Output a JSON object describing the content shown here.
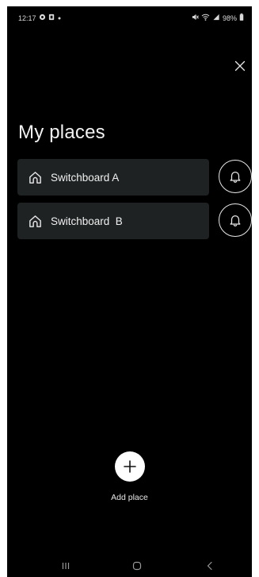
{
  "status_bar": {
    "time": "12:17",
    "battery": "98%",
    "left_icons": [
      "whatsapp-icon",
      "notification-icon",
      "dot-icon"
    ],
    "right_icons": [
      "mute-icon",
      "wifi-icon",
      "signal-icon",
      "battery-icon"
    ]
  },
  "header": {
    "title": "My places",
    "close_icon": "close-icon"
  },
  "places": [
    {
      "name": "Switchboard A",
      "icon": "home-icon",
      "action_icon": "bell-icon"
    },
    {
      "name": "Switchboard  B",
      "icon": "home-icon",
      "action_icon": "bell-icon"
    }
  ],
  "add_place": {
    "label": "Add place",
    "icon": "plus-icon"
  },
  "navigation": {
    "items": [
      "recent-apps-icon",
      "home-nav-icon",
      "back-icon"
    ]
  },
  "colors": {
    "background": "#000000",
    "card": "#1e2223",
    "text": "#f2f2f2",
    "accent_button": "#ffffff"
  }
}
